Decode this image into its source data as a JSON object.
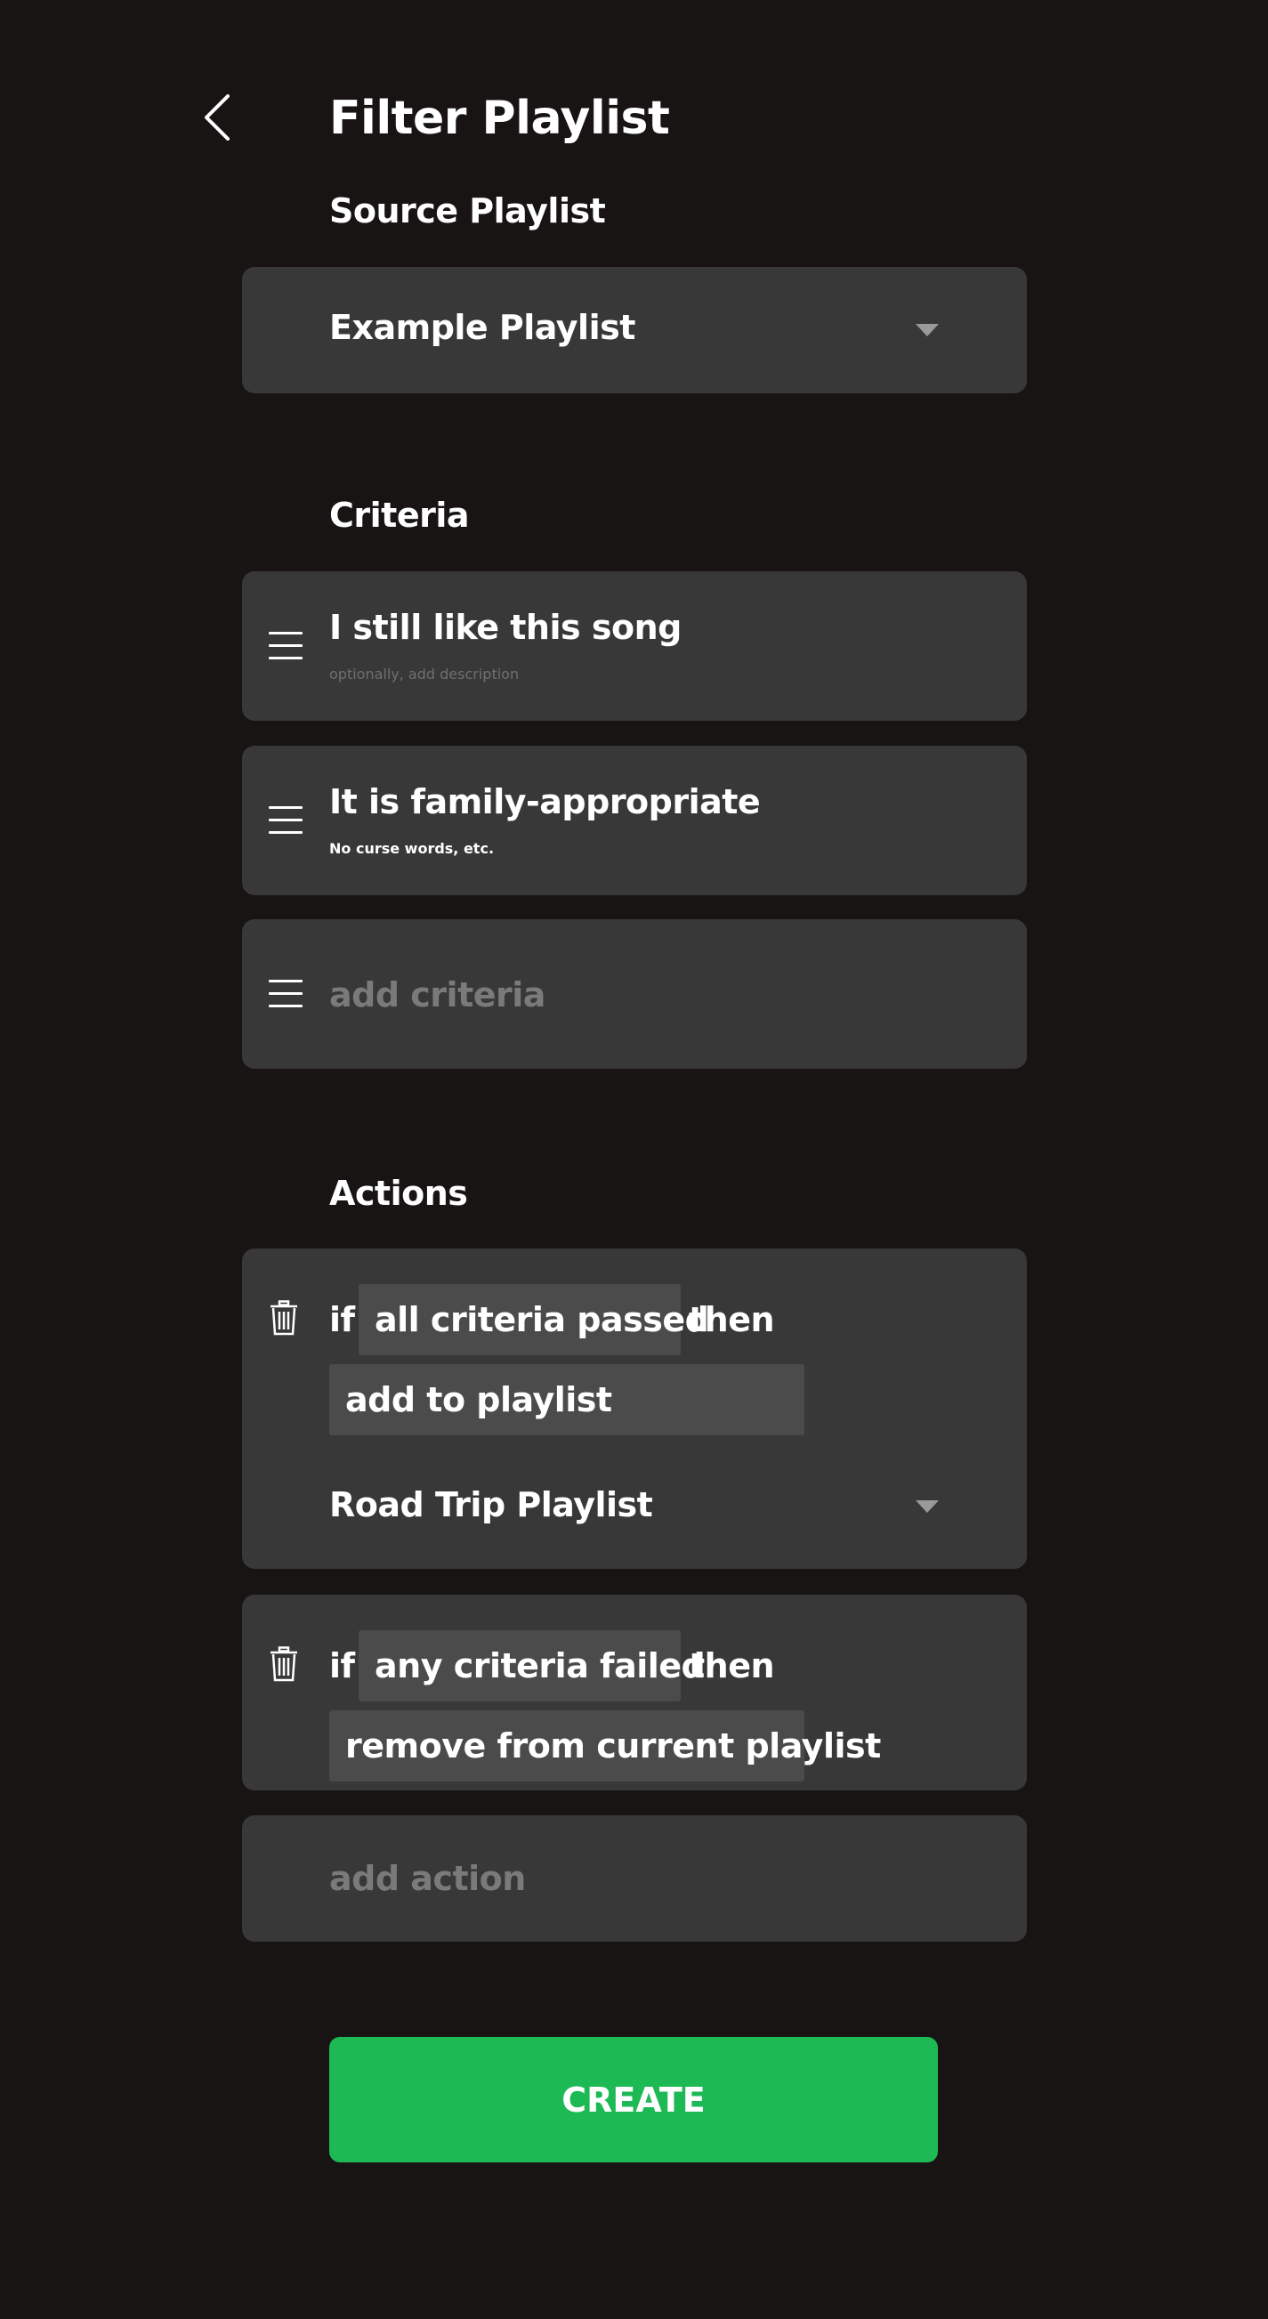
{
  "header": {
    "title": "Filter Playlist"
  },
  "source": {
    "label": "Source Playlist",
    "selected": "Example Playlist"
  },
  "criteria": {
    "label": "Criteria",
    "items": [
      {
        "title": "I still like this song",
        "description": "optionally, add description"
      },
      {
        "title": "It is family-appropriate",
        "description": "No curse words, etc."
      }
    ],
    "add_placeholder": "add criteria"
  },
  "actions": {
    "label": "Actions",
    "if_word": "if",
    "then_word": "then",
    "items": [
      {
        "condition": "all criteria passed",
        "action": "add to playlist",
        "target_playlist": "Road Trip Playlist"
      },
      {
        "condition": "any criteria failed",
        "action": "remove from current playlist"
      }
    ],
    "add_placeholder": "add action"
  },
  "create_button": {
    "label": "CREATE"
  },
  "icons": {
    "back": "chevron-left-icon",
    "dropdown": "caret-down-icon",
    "drag": "drag-handle-icon",
    "delete": "trash-icon"
  },
  "colors": {
    "background": "#181414",
    "card": "#383838",
    "chip": "#4b4b4b",
    "accent": "#1db954",
    "muted_text": "#7a7a7a"
  }
}
